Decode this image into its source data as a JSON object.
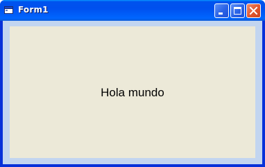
{
  "window": {
    "title": "Form1"
  },
  "form": {
    "label_text": "Hola mundo"
  },
  "icons": {
    "app": "form-window-icon",
    "minimize": "minimize-icon",
    "maximize": "maximize-icon",
    "close": "close-icon"
  },
  "colors": {
    "titlebar": "#0053ee",
    "frame": "#c2d5f0",
    "client": "#ece9d8",
    "close_button": "#e2552c"
  }
}
